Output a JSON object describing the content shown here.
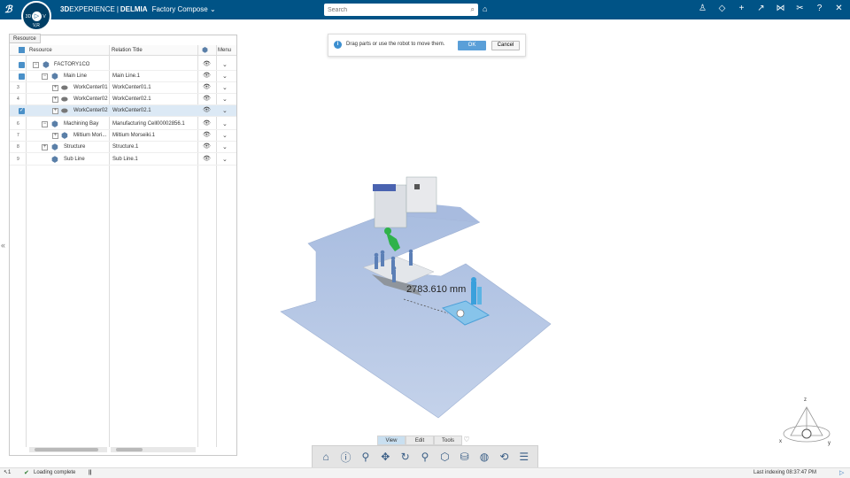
{
  "topbar": {
    "brand": "3D",
    "brand_rest": "EXPERIENCE",
    "separator": "|",
    "product_bold": "DELMIA",
    "app_name": "Factory Compose",
    "search_placeholder": "Search",
    "compass": {
      "top_left": "3D",
      "top_right": "V",
      "bottom": "V,R"
    }
  },
  "panel": {
    "tab_label": "Resource",
    "columns": {
      "resource": "Resource",
      "relation": "Relation Title",
      "menu": "Menu"
    },
    "rows": [
      {
        "num": "",
        "name": "FACTORY1CO",
        "relation": "",
        "indent": 0
      },
      {
        "num": "",
        "name": "Main Line",
        "relation": "Main Line.1",
        "indent": 1
      },
      {
        "num": "3",
        "name": "WorkCenter01",
        "relation": "WorkCenter01.1",
        "indent": 2
      },
      {
        "num": "4",
        "name": "WorkCenter02",
        "relation": "WorkCenter02.1",
        "indent": 2
      },
      {
        "num": "",
        "name": "WorkCenter02",
        "relation": "WorkCenter02.1",
        "indent": 2
      },
      {
        "num": "6",
        "name": "Machining Bay",
        "relation": "Manufacturing Cell00002856.1",
        "indent": 1
      },
      {
        "num": "7",
        "name": "Miltium Mori...",
        "relation": "Miltium Morseiki.1",
        "indent": 2
      },
      {
        "num": "8",
        "name": "Structure",
        "relation": "Structure.1",
        "indent": 1
      },
      {
        "num": "9",
        "name": "Sub Line",
        "relation": "Sub Line.1",
        "indent": 1
      }
    ]
  },
  "notification": {
    "message": "Drag parts or use the robot to move them.",
    "ok_label": "OK",
    "cancel_label": "Cancel"
  },
  "viewport": {
    "measurement": "2783.610 mm"
  },
  "section_tabs": {
    "view": "View",
    "edit": "Edit",
    "tools": "Tools"
  },
  "axis": {
    "z": "z",
    "x": "x",
    "y": "y"
  },
  "status": {
    "count": "1",
    "message": "Loading complete",
    "indexing_label": "Last indexing",
    "indexing_time": "08:37:47 PM"
  },
  "colors": {
    "topbar": "#005386",
    "floor": "#b7c9e6",
    "accent": "#3c8fd0"
  }
}
